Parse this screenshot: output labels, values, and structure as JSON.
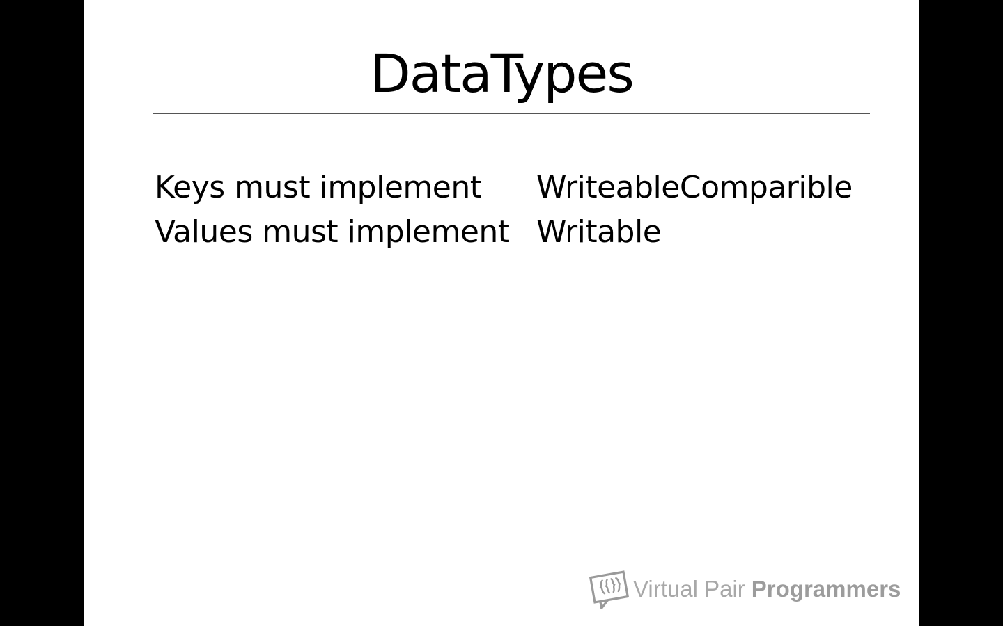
{
  "slide": {
    "title": "DataTypes",
    "rows": [
      {
        "label": "Keys must implement",
        "value": "WriteableComparible"
      },
      {
        "label": "Values must implement",
        "value": "Writable"
      }
    ]
  },
  "branding": {
    "logo_icon": "speech-faces-logo-icon",
    "name_light": "Virtual Pair",
    "name_bold": "Programmers",
    "color": "#9a9a9a"
  }
}
